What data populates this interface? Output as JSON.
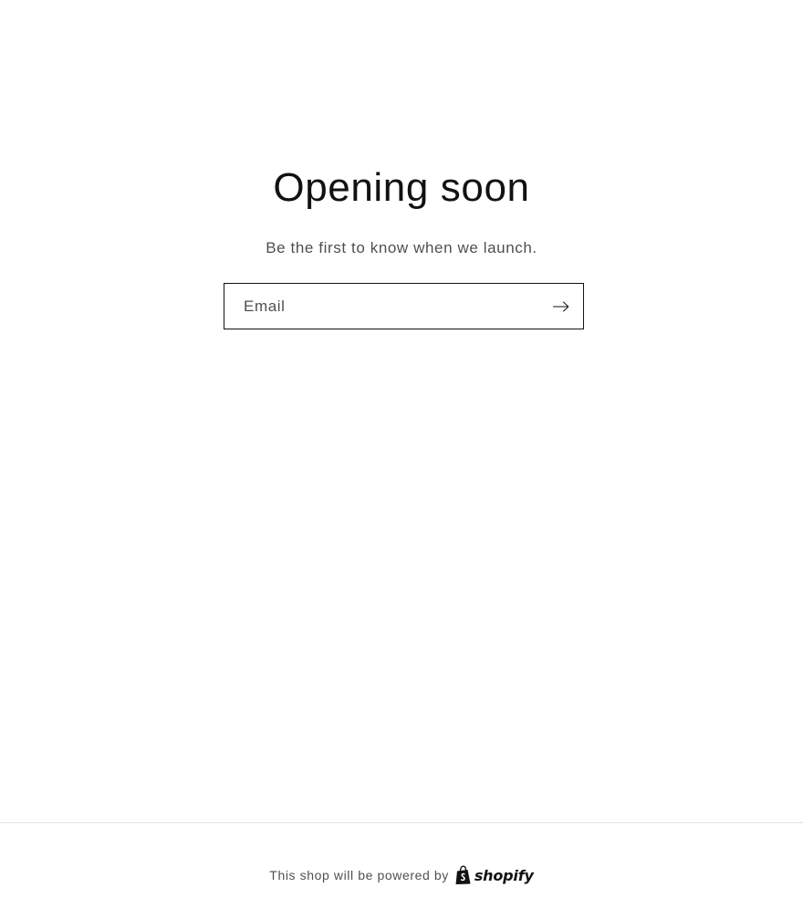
{
  "main": {
    "title": "Opening soon",
    "subtitle": "Be the first to know when we launch.",
    "email_form": {
      "placeholder": "Email",
      "value": "",
      "submit_icon": "arrow-right-icon"
    }
  },
  "footer": {
    "powered_by_text": "This shop will be powered by",
    "brand_logo": {
      "icon": "shopify-bag-icon",
      "wordmark": "shopify"
    }
  },
  "colors": {
    "text": "#121212",
    "background": "#ffffff"
  }
}
